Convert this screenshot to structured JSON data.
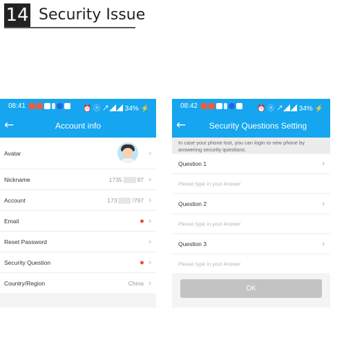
{
  "header": {
    "step_number": "14",
    "title": "Security Issue"
  },
  "left_phone": {
    "status": {
      "time": "08:41",
      "right": "⏰ ⓝ ↗◢◢ 34% ⚡"
    },
    "title": "Account info",
    "back_icon": "back-arrow-icon",
    "rows": [
      {
        "label": "Avatar"
      },
      {
        "label": "Nickname",
        "value_a": "1735",
        "value_b": "97"
      },
      {
        "label": "Account",
        "value_a": "173",
        "value_b": "!797"
      },
      {
        "label": "Email"
      },
      {
        "label": "Reset Password"
      },
      {
        "label": "Security Question"
      },
      {
        "label": "Country/Region",
        "value": "China"
      }
    ],
    "chevron": "›"
  },
  "right_phone": {
    "status": {
      "time": "08:42",
      "right": "⏰ ⓝ ↗◢◢ 34% ⚡"
    },
    "title": "Security Questions Setting",
    "note": "In case your phone lost, you can login to new phone by answering security questions.",
    "questions": [
      {
        "label": "Question 1",
        "placeholder": "Please type in your Answer"
      },
      {
        "label": "Question 2",
        "placeholder": "Please type in your Answer"
      },
      {
        "label": "Question 3",
        "placeholder": "Please type in your Answer"
      }
    ],
    "ok_label": "OK",
    "chevron": "›"
  },
  "colors": {
    "accent": "#15a6ef",
    "dot": "#f04a3a",
    "button": "#c3c3c3"
  }
}
